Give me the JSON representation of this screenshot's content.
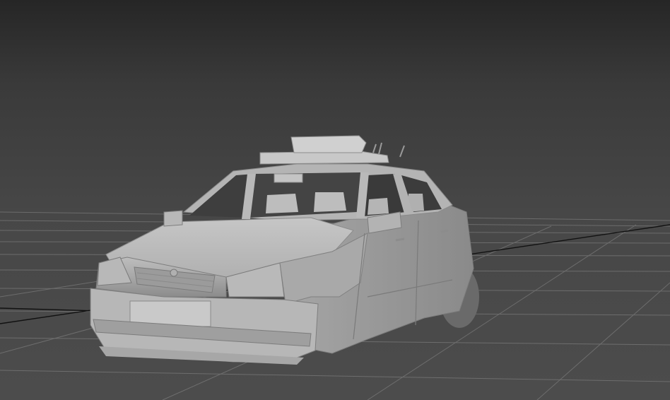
{
  "viewport": {
    "label": "",
    "colors": {
      "background_top": "#262626",
      "background_bottom": "#4c4c4c",
      "grid_line": "#7a7a7a",
      "axis_line": "#111111",
      "model_shade": "#9e9e9e",
      "model_highlight": "#cfcfcf"
    }
  },
  "scene": {
    "object": "car-model",
    "render_mode": "shaded-gray",
    "grid": true
  }
}
